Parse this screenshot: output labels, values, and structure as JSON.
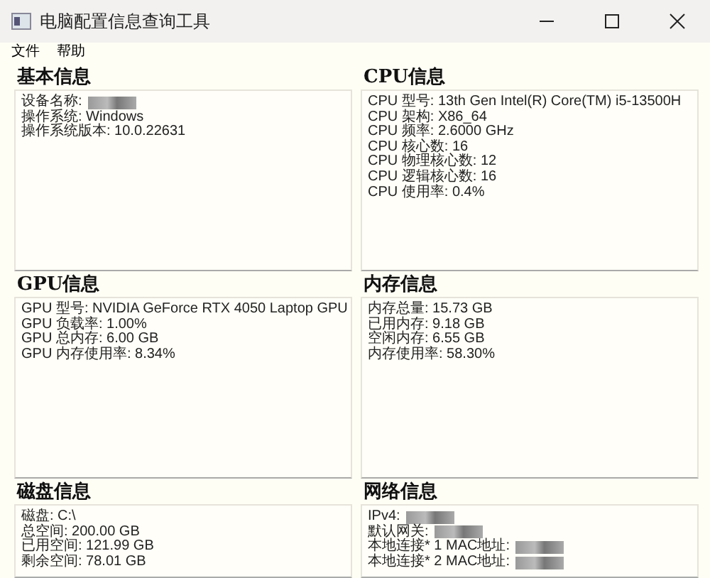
{
  "window": {
    "title": "电脑配置信息查询工具"
  },
  "menu": [
    "文件",
    "帮助"
  ],
  "panels": [
    {
      "title": "基本信息",
      "lines": [
        {
          "text": "设备名称:",
          "redacted": true
        },
        {
          "text": "操作系统: Windows"
        },
        {
          "text": "操作系统版本: 10.0.22631"
        }
      ]
    },
    {
      "title": "CPU信息",
      "lines": [
        {
          "text": "CPU 型号: 13th Gen Intel(R) Core(TM) i5-13500H"
        },
        {
          "text": "CPU 架构: X86_64"
        },
        {
          "text": "CPU 频率: 2.6000 GHz"
        },
        {
          "text": "CPU 核心数: 16"
        },
        {
          "text": "CPU 物理核心数: 12"
        },
        {
          "text": "CPU 逻辑核心数: 16"
        },
        {
          "text": "CPU 使用率: 0.4%"
        }
      ]
    },
    {
      "title": "GPU信息",
      "lines": [
        {
          "text": "GPU 型号: NVIDIA GeForce RTX 4050 Laptop GPU"
        },
        {
          "text": "GPU 负载率: 1.00%"
        },
        {
          "text": "GPU 总内存: 6.00 GB"
        },
        {
          "text": "GPU 内存使用率: 8.34%"
        }
      ]
    },
    {
      "title": "内存信息",
      "lines": [
        {
          "text": "内存总量: 15.73 GB"
        },
        {
          "text": "已用内存: 9.18 GB"
        },
        {
          "text": "空闲内存: 6.55 GB"
        },
        {
          "text": "内存使用率: 58.30%"
        }
      ]
    },
    {
      "title": "磁盘信息",
      "lines": [
        {
          "text": "磁盘: C:\\"
        },
        {
          "text": "总空间: 200.00 GB"
        },
        {
          "text": "已用空间: 121.99 GB"
        },
        {
          "text": "剩余空间: 78.01 GB"
        }
      ]
    },
    {
      "title": "网络信息",
      "lines": [
        {
          "text": "IPv4:",
          "redacted": true
        },
        {
          "text": "默认网关:",
          "redacted": true
        },
        {
          "text": "本地连接* 1  MAC地址:",
          "redacted": true
        },
        {
          "text": "本地连接* 2  MAC地址:",
          "redacted": true
        }
      ]
    }
  ]
}
